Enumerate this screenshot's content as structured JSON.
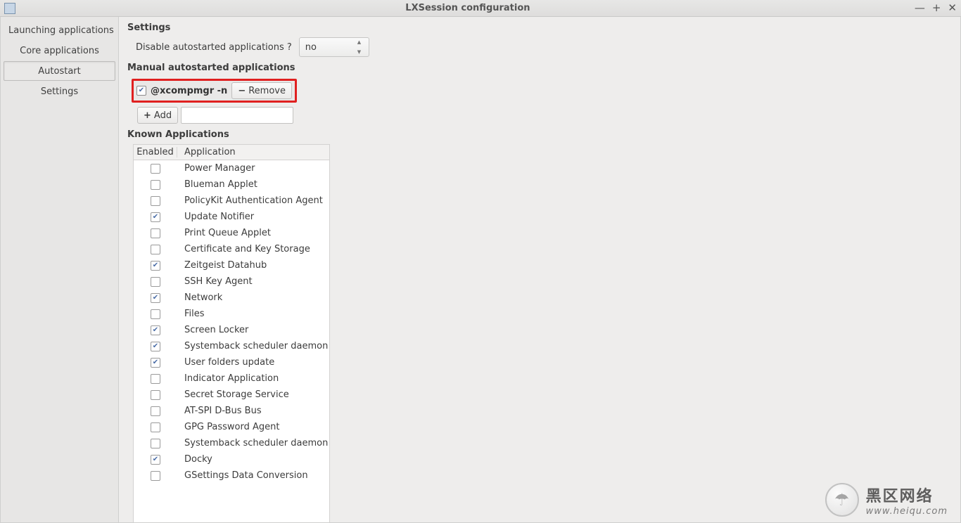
{
  "window": {
    "title": "LXSession configuration"
  },
  "sidebar": {
    "tabs": [
      {
        "label": "Launching applications",
        "active": false
      },
      {
        "label": "Core applications",
        "active": false
      },
      {
        "label": "Autostart",
        "active": true
      },
      {
        "label": "Settings",
        "active": false
      }
    ]
  },
  "settings": {
    "heading": "Settings",
    "disable_label": "Disable autostarted applications ?",
    "disable_value": "no"
  },
  "manual": {
    "heading": "Manual autostarted applications",
    "entry_checked": true,
    "entry_cmd": "@xcompmgr -n",
    "remove_label": "Remove",
    "add_label": "Add",
    "add_value": ""
  },
  "known": {
    "heading": "Known Applications",
    "col_enabled": "Enabled",
    "col_app": "Application",
    "rows": [
      {
        "enabled": false,
        "app": "Power Manager"
      },
      {
        "enabled": false,
        "app": "Blueman Applet"
      },
      {
        "enabled": false,
        "app": "PolicyKit Authentication Agent"
      },
      {
        "enabled": true,
        "app": "Update Notifier"
      },
      {
        "enabled": false,
        "app": "Print Queue Applet"
      },
      {
        "enabled": false,
        "app": "Certificate and Key Storage"
      },
      {
        "enabled": true,
        "app": "Zeitgeist Datahub"
      },
      {
        "enabled": false,
        "app": "SSH Key Agent"
      },
      {
        "enabled": true,
        "app": "Network"
      },
      {
        "enabled": false,
        "app": "Files"
      },
      {
        "enabled": true,
        "app": "Screen Locker"
      },
      {
        "enabled": true,
        "app": "Systemback scheduler daemon"
      },
      {
        "enabled": true,
        "app": "User folders update"
      },
      {
        "enabled": false,
        "app": "Indicator Application"
      },
      {
        "enabled": false,
        "app": "Secret Storage Service"
      },
      {
        "enabled": false,
        "app": "AT-SPI D-Bus Bus"
      },
      {
        "enabled": false,
        "app": "GPG Password Agent"
      },
      {
        "enabled": false,
        "app": "Systemback scheduler daemon"
      },
      {
        "enabled": true,
        "app": "Docky"
      },
      {
        "enabled": false,
        "app": "GSettings Data Conversion"
      }
    ]
  },
  "watermark": {
    "cn": "黑区网络",
    "url": "www.heiqu.com"
  }
}
